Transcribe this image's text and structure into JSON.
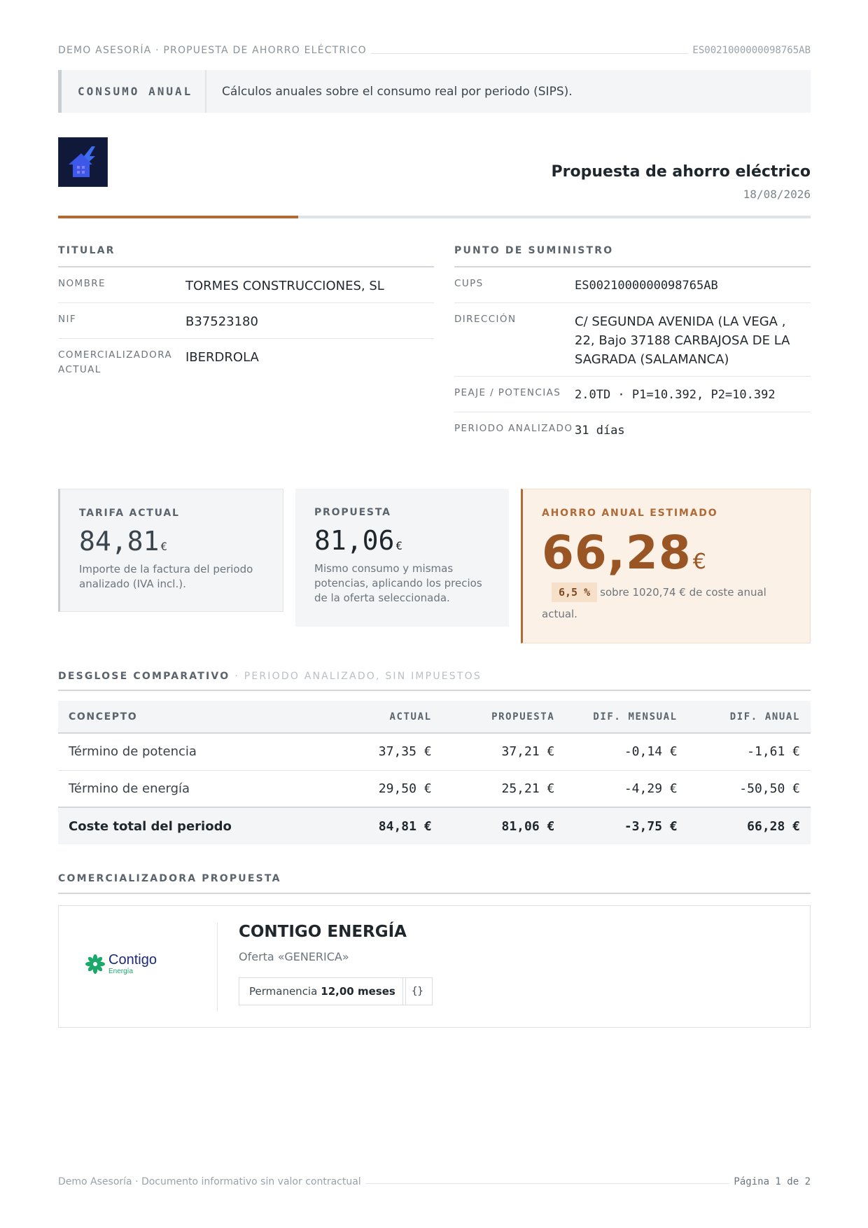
{
  "topbar": {
    "left": "DEMO ASESORÍA · PROPUESTA DE AHORRO ELÉCTRICO",
    "right": "ES0021000000098765AB"
  },
  "banner": {
    "tag": "CONSUMO ANUAL",
    "text": "Cálculos anuales sobre el consumo real por periodo (SIPS)."
  },
  "header": {
    "title": "Propuesta de ahorro eléctrico",
    "date": "18/08/2026",
    "logo_icon": "house-lightning-icon"
  },
  "titular": {
    "label": "TITULAR",
    "rows": [
      {
        "key": "NOMBRE",
        "value": "TORMES CONSTRUCCIONES, SL"
      },
      {
        "key": "NIF",
        "value": "B37523180"
      },
      {
        "key": "COMERCIALIZADORA ACTUAL",
        "value": "IBERDROLA"
      }
    ]
  },
  "suministro": {
    "label": "PUNTO DE SUMINISTRO",
    "rows": [
      {
        "key": "CUPS",
        "value": "ES0021000000098765AB"
      },
      {
        "key": "DIRECCIÓN",
        "value": "C/ SEGUNDA AVENIDA (LA VEGA , 22, Bajo 37188 CARBAJOSA DE LA SAGRADA (SALAMANCA)"
      },
      {
        "key": "PEAJE / POTENCIAS",
        "value": "2.0TD · P1=10.392, P2=10.392"
      },
      {
        "key": "PERIODO ANALIZADO",
        "value": "31 días"
      }
    ]
  },
  "cards": {
    "actual": {
      "label": "TARIFA ACTUAL",
      "amount": "84,81",
      "currency": "€",
      "desc": "Importe de la factura del periodo analizado (IVA incl.)."
    },
    "propuesta": {
      "label": "PROPUESTA",
      "amount": "81,06",
      "currency": "€",
      "desc": "Mismo consumo y mismas potencias, aplicando los precios de la oferta seleccionada."
    },
    "ahorro": {
      "label": "AHORRO ANUAL ESTIMADO",
      "amount": "66,28",
      "currency": "€",
      "pill": "6,5 %",
      "pill_text": "sobre 1020,74 € de coste anual",
      "desc": "actual."
    }
  },
  "desglose": {
    "label": "DESGLOSE COMPARATIVO",
    "sub": "· PERIODO ANALIZADO, SIN IMPUESTOS",
    "columns": [
      "CONCEPTO",
      "ACTUAL",
      "PROPUESTA",
      "DIF. MENSUAL",
      "DIF. ANUAL"
    ],
    "rows": [
      {
        "concept": "Término de potencia",
        "actual": "37,35 €",
        "propuesta": "37,21 €",
        "dif_mensual": "-0,14 €",
        "dif_anual": "-1,61 €"
      },
      {
        "concept": "Término de energía",
        "actual": "29,50 €",
        "propuesta": "25,21 €",
        "dif_mensual": "-4,29 €",
        "dif_anual": "-50,50 €"
      }
    ],
    "total": {
      "concept": "Coste total del periodo",
      "actual": "84,81 €",
      "propuesta": "81,06 €",
      "dif_mensual": "-3,75 €",
      "dif_anual": "66,28 €"
    }
  },
  "comercializadora": {
    "label": "COMERCIALIZADORA PROPUESTA",
    "logo_word": "Contigo",
    "logo_sub": "Energía",
    "name": "CONTIGO ENERGÍA",
    "offer": "Oferta «GENERICA»",
    "permanencia_label": "Permanencia",
    "permanencia_value": "12,00 meses",
    "extra": "{}"
  },
  "footer": {
    "left": "Demo Asesoría · Documento informativo sin valor contractual",
    "right": "Página 1 de 2"
  },
  "colors": {
    "accent": "#b06a35",
    "savings": "#9a5525",
    "brand_green": "#1aa96a",
    "brand_blue": "#1b2a7a"
  }
}
